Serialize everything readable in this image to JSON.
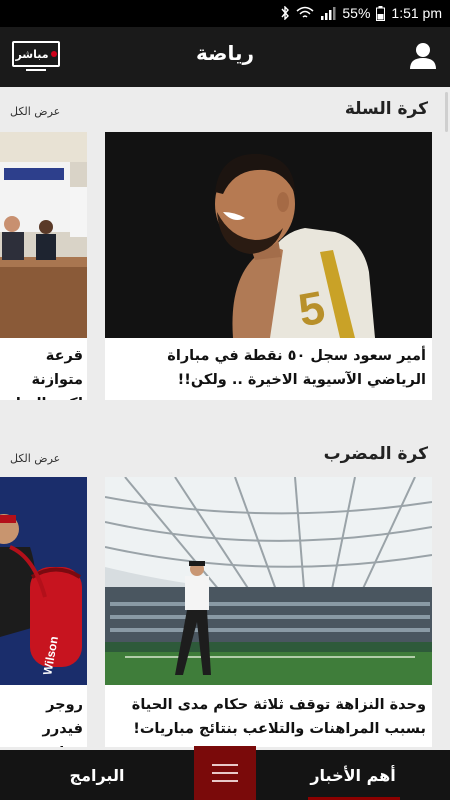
{
  "status_bar": {
    "battery_percent": "55%",
    "time": "1:51 pm",
    "icons": [
      "bluetooth-icon",
      "wifi-icon",
      "signal-icon",
      "battery-icon"
    ]
  },
  "app_bar": {
    "title": "رياضة",
    "live_label": "مباشر",
    "user_icon": "user-icon"
  },
  "sections": [
    {
      "title": "كرة السلة",
      "view_all": "عرض الكل",
      "cards": [
        {
          "text": "أمير سعود سجل ٥٠ نقطة في مباراة الرياضي الآسيوية الاخيرة .. ولكن!!",
          "image": "basketball-player-photo"
        },
        {
          "text": "قرعة متوازنة لكرة السلة",
          "image": "press-conference-photo"
        }
      ]
    },
    {
      "title": "كرة المضرب",
      "view_all": "عرض الكل",
      "cards": [
        {
          "text": "وحدة النزاهة توقف ثلاثة حكام مدى الحياة بسبب المراهنات والتلاعب بنتائج مباريات!",
          "image": "tennis-stadium-photo"
        },
        {
          "text": "روجر فيدرر رعاية جديد",
          "image": "tennis-player-photo"
        }
      ]
    }
  ],
  "bottom_nav": {
    "news_label": "أهم الأخبار",
    "programs_label": "البرامج",
    "menu_icon": "hamburger-menu-icon"
  },
  "colors": {
    "accent": "#7a0a0a",
    "app_bar": "#1a1a1a",
    "background": "#ececec"
  }
}
